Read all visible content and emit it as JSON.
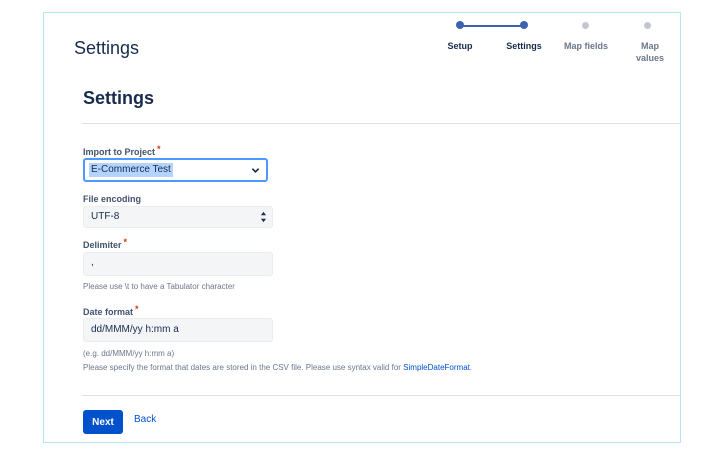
{
  "header": {
    "title": "Settings"
  },
  "tracker": {
    "steps": [
      {
        "label": "Setup",
        "state": "done"
      },
      {
        "label": "Settings",
        "state": "current"
      },
      {
        "label": "Map fields",
        "state": "todo"
      },
      {
        "label": "Map values",
        "state": "todo"
      }
    ],
    "colors": {
      "done": "#3d63b0",
      "todo": "#c1c7d0"
    }
  },
  "form": {
    "title": "Settings",
    "project": {
      "label": "Import to Project",
      "required_mark": "*",
      "value": "E-Commerce Test"
    },
    "encoding": {
      "label": "File encoding",
      "value": "UTF-8"
    },
    "delimiter": {
      "label": "Delimiter",
      "required_mark": "*",
      "value": ",",
      "help": "Please use \\t to have a Tabulator character"
    },
    "date_format": {
      "label": "Date format",
      "required_mark": "*",
      "value": "dd/MMM/yy h:mm a",
      "example": "(e.g. dd/MMM/yy h:mm a)",
      "help_prefix": "Please specify the format that dates are stored in the CSV file. Please use syntax valid for ",
      "help_link": "SimpleDateFormat",
      "help_suffix": "."
    }
  },
  "actions": {
    "next": "Next",
    "back": "Back"
  }
}
